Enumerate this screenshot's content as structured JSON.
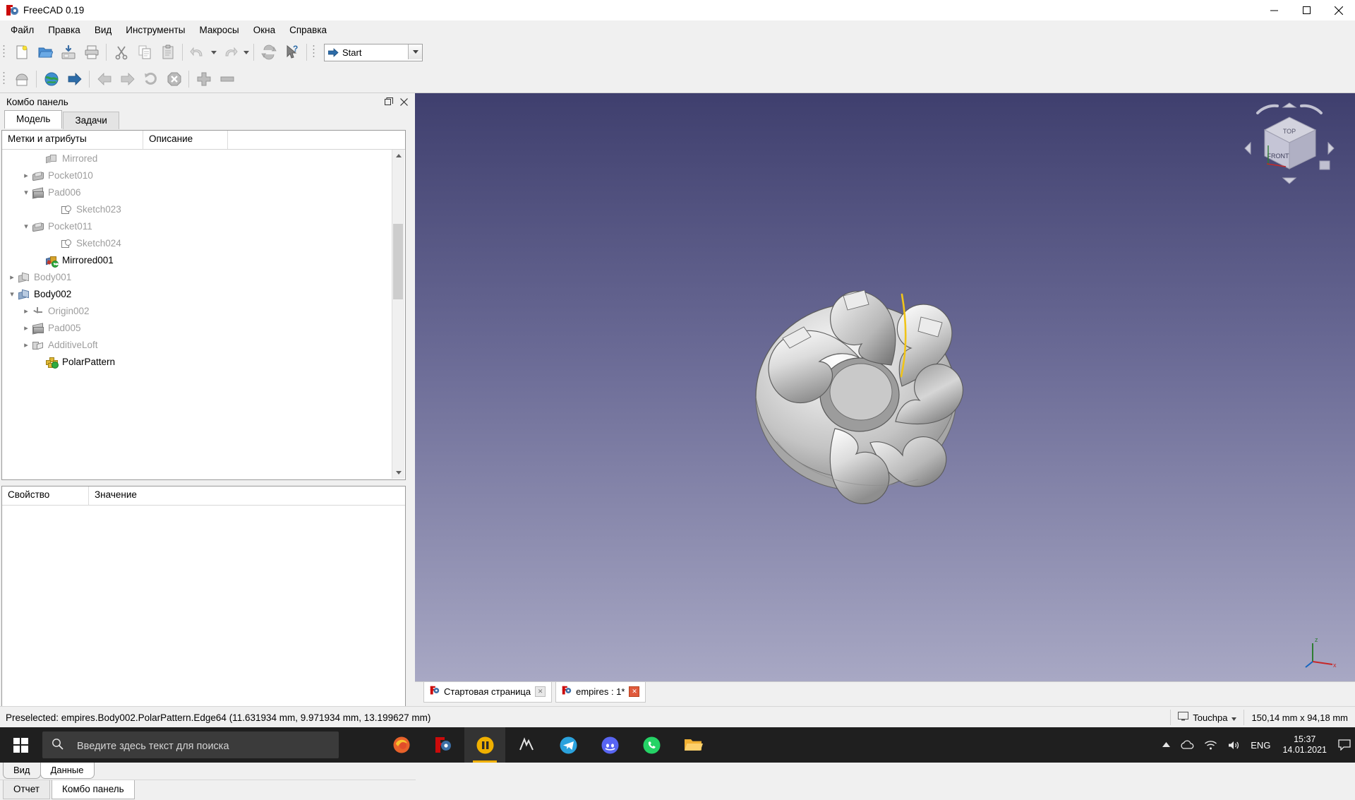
{
  "window": {
    "title": "FreeCAD 0.19",
    "app_icon": "freecad-logo-icon",
    "minimize": "minimize-icon",
    "maximize": "maximize-icon",
    "close": "close-icon"
  },
  "menubar": {
    "items": [
      {
        "label": "Файл"
      },
      {
        "label": "Правка"
      },
      {
        "label": "Вид"
      },
      {
        "label": "Инструменты"
      },
      {
        "label": "Макросы"
      },
      {
        "label": "Окна"
      },
      {
        "label": "Справка"
      }
    ]
  },
  "toolbar_main": {
    "buttons": [
      {
        "name": "new-document-button",
        "icon": "new-file-icon"
      },
      {
        "name": "open-document-button",
        "icon": "open-folder-icon"
      },
      {
        "name": "save-document-button",
        "icon": "save-icon"
      },
      {
        "name": "print-button",
        "icon": "printer-icon"
      },
      {
        "name": "cut-button",
        "icon": "scissors-icon"
      },
      {
        "name": "copy-button",
        "icon": "copy-icon"
      },
      {
        "name": "paste-button",
        "icon": "clipboard-icon"
      },
      {
        "name": "undo-button",
        "icon": "undo-arrow-icon"
      },
      {
        "name": "redo-button",
        "icon": "redo-arrow-icon"
      },
      {
        "name": "refresh-button",
        "icon": "refresh-icon"
      },
      {
        "name": "whats-this-button",
        "icon": "cursor-question-icon"
      }
    ],
    "workbench": {
      "label": "Start",
      "icon": "blue-arrow-icon",
      "dropdown": "chevron-down-icon"
    }
  },
  "toolbar_secondary": {
    "buttons": [
      {
        "name": "start-workbench-button",
        "icon": "start-page-icon"
      },
      {
        "name": "web-browser-button",
        "icon": "globe-icon"
      },
      {
        "name": "navigate-button",
        "icon": "blue-arrow-icon"
      },
      {
        "name": "back-button",
        "icon": "back-arrow-icon"
      },
      {
        "name": "forward-button",
        "icon": "forward-arrow-icon"
      },
      {
        "name": "reload-button",
        "icon": "reload-icon"
      },
      {
        "name": "stop-loading-button",
        "icon": "stop-x-icon"
      },
      {
        "name": "zoom-in-button",
        "icon": "plus-icon"
      },
      {
        "name": "zoom-out-button",
        "icon": "minus-icon"
      }
    ]
  },
  "combo_panel": {
    "title": "Комбо панель",
    "float_icon": "restore-window-icon",
    "close_icon": "close-icon",
    "tabs": [
      {
        "label": "Модель",
        "active": true
      },
      {
        "label": "Задачи",
        "active": false
      }
    ],
    "tree_headers": [
      "Метки и атрибуты",
      "Описание",
      ""
    ],
    "tree_items": [
      {
        "label": "Mirrored",
        "indent": 3,
        "expander": "none",
        "icon": "mirrored-feature-icon",
        "bold": false
      },
      {
        "label": "Pocket010",
        "indent": 2,
        "expander": "collapsed",
        "icon": "pocket-icon",
        "bold": false
      },
      {
        "label": "Pad006",
        "indent": 2,
        "expander": "expanded",
        "icon": "pad-icon",
        "bold": false
      },
      {
        "label": "Sketch023",
        "indent": 4,
        "expander": "none",
        "icon": "sketch-icon",
        "bold": false
      },
      {
        "label": "Pocket011",
        "indent": 2,
        "expander": "expanded",
        "icon": "pocket-icon",
        "bold": false
      },
      {
        "label": "Sketch024",
        "indent": 4,
        "expander": "none",
        "icon": "sketch-icon",
        "bold": false
      },
      {
        "label": "Mirrored001",
        "indent": 3,
        "expander": "none",
        "icon": "mirrored-tip-icon",
        "bold": true
      },
      {
        "label": "Body001",
        "indent": 1,
        "expander": "collapsed",
        "icon": "body-icon-gray",
        "bold": false
      },
      {
        "label": "Body002",
        "indent": 1,
        "expander": "expanded",
        "icon": "body-icon-blue",
        "bold": true
      },
      {
        "label": "Origin002",
        "indent": 2,
        "expander": "collapsed",
        "icon": "origin-axes-icon",
        "bold": false
      },
      {
        "label": "Pad005",
        "indent": 2,
        "expander": "collapsed",
        "icon": "pad-icon",
        "bold": false
      },
      {
        "label": "AdditiveLoft",
        "indent": 2,
        "expander": "collapsed",
        "icon": "additive-loft-icon",
        "bold": false
      },
      {
        "label": "PolarPattern",
        "indent": 3,
        "expander": "none",
        "icon": "polar-pattern-tip-icon",
        "bold": true
      }
    ],
    "property_headers": [
      "Свойство",
      "Значение"
    ],
    "property_rows": [],
    "view_data_tabs": [
      {
        "label": "Вид",
        "active": false
      },
      {
        "label": "Данные",
        "active": true
      }
    ],
    "bottom_tabs": [
      {
        "label": "Отчет",
        "active": false
      },
      {
        "label": "Комбо панель",
        "active": true
      }
    ]
  },
  "view3d": {
    "navcube": {
      "top_face": "TOP",
      "front_face": "FRONT"
    },
    "axis_labels": {
      "z": "z",
      "x": "x"
    },
    "doc_tabs": [
      {
        "label": "Стартовая страница",
        "icon": "freecad-logo-icon",
        "close": "close-icon",
        "active": false
      },
      {
        "label": "empires : 1*",
        "icon": "freecad-logo-icon",
        "close": "close-icon",
        "active": true
      }
    ]
  },
  "statusbar": {
    "message": "Preselected: empires.Body002.PolarPattern.Edge64 (11.631934 mm, 9.971934 mm, 13.199627 mm)",
    "navigation": {
      "label": "Touchpa",
      "icon": "monitor-icon",
      "dropdown": "chevron-down-icon"
    },
    "dimensions": "150,14 mm x 94,18 mm"
  },
  "taskbar": {
    "start_icon": "windows-start-icon",
    "search_placeholder": "Введите здесь текст для поиска",
    "search_icon": "magnifier-icon",
    "apps": [
      {
        "name": "firefox-taskbar-icon",
        "active": false
      },
      {
        "name": "freecad-taskbar-icon",
        "active": false
      },
      {
        "name": "media-taskbar-icon",
        "active": true
      },
      {
        "name": "mixer-taskbar-icon",
        "active": false
      },
      {
        "name": "telegram-taskbar-icon",
        "active": false
      },
      {
        "name": "discord-taskbar-icon",
        "active": false
      },
      {
        "name": "whatsapp-taskbar-icon",
        "active": false
      },
      {
        "name": "file-explorer-taskbar-icon",
        "active": false
      }
    ],
    "tray": {
      "expand_icon": "chevron-up-icon",
      "onedrive_icon": "cloud-icon",
      "network_icon": "wifi-icon",
      "volume_icon": "speaker-icon",
      "language": "ENG",
      "time": "15:37",
      "date": "14.01.2021",
      "notifications_icon": "speech-bubble-icon"
    }
  },
  "colors": {
    "accent": "#f0b000",
    "view_top": "#3f3f6e",
    "view_bottom": "#a8a8c4",
    "highlight_edge": "#f0c419"
  }
}
